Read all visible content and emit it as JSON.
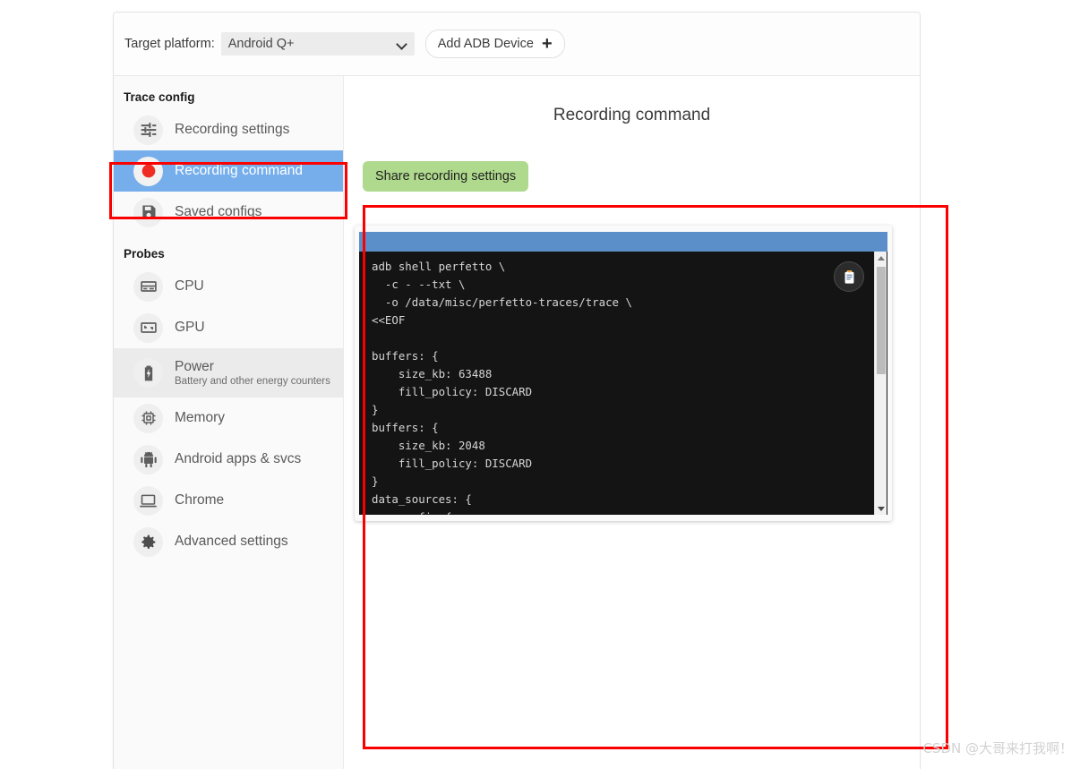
{
  "topbar": {
    "target_platform_label": "Target platform:",
    "platform_value": "Android Q+",
    "add_adb_label": "Add ADB Device",
    "add_adb_plus": "+"
  },
  "sidebar": {
    "sections": [
      {
        "title": "Trace config"
      },
      {
        "title": "Probes"
      }
    ],
    "trace_config_items": [
      {
        "label": "Recording settings",
        "icon": "tune-sliders-icon",
        "state": "normal"
      },
      {
        "label": "Recording command",
        "icon": "record-circle-icon",
        "state": "selected"
      },
      {
        "label": "Saved configs",
        "icon": "floppy-save-icon",
        "state": "normal"
      }
    ],
    "probe_items": [
      {
        "label": "CPU",
        "sub": "",
        "icon": "cpu-icon",
        "state": "normal"
      },
      {
        "label": "GPU",
        "sub": "",
        "icon": "gpu-icon",
        "state": "normal"
      },
      {
        "label": "Power",
        "sub": "Battery and other energy counters",
        "icon": "battery-bolt-icon",
        "state": "hovered"
      },
      {
        "label": "Memory",
        "sub": "",
        "icon": "memory-chip-icon",
        "state": "normal"
      },
      {
        "label": "Android apps & svcs",
        "sub": "",
        "icon": "android-robot-icon",
        "state": "normal"
      },
      {
        "label": "Chrome",
        "sub": "",
        "icon": "laptop-icon",
        "state": "normal"
      },
      {
        "label": "Advanced settings",
        "sub": "",
        "icon": "gear-icon",
        "state": "normal"
      }
    ]
  },
  "main": {
    "title": "Recording command",
    "share_button_label": "Share recording settings",
    "copy_icon": "clipboard-copy-icon",
    "command_text": "adb shell perfetto \\\n  -c - --txt \\\n  -o /data/misc/perfetto-traces/trace \\\n<<EOF\n\nbuffers: {\n    size_kb: 63488\n    fill_policy: DISCARD\n}\nbuffers: {\n    size_kb: 2048\n    fill_policy: DISCARD\n}\ndata_sources: {\n    config {\n        name: \"android.power\"\n        android_power_config {\n            battery_poll_ms: 1000\n            battery_counters: BATTERY_COUNTER_CAPACITY_PERCENT\n            battery_counters: BATTERY_COUNTER_CHARGE\n            battery_counters: BATTERY_COUNTER_CURRENT\n            collect_power_rails: true\n        }\n    }\n}\ndata_sources: {"
  },
  "annotations": {
    "color": "#fb0000",
    "boxes": [
      "recording-command-sidebar-item",
      "recording-command-code-block"
    ]
  },
  "watermark": {
    "text": "CSDN @大哥来打我啊！"
  },
  "colors": {
    "selected_item_bg": "#76aeeb",
    "hover_item_bg": "#ebebeb",
    "share_button_bg": "#afd98c",
    "code_bg": "#141414",
    "code_header_blue": "#5b8fc9",
    "annotation_red": "#fb0000"
  }
}
